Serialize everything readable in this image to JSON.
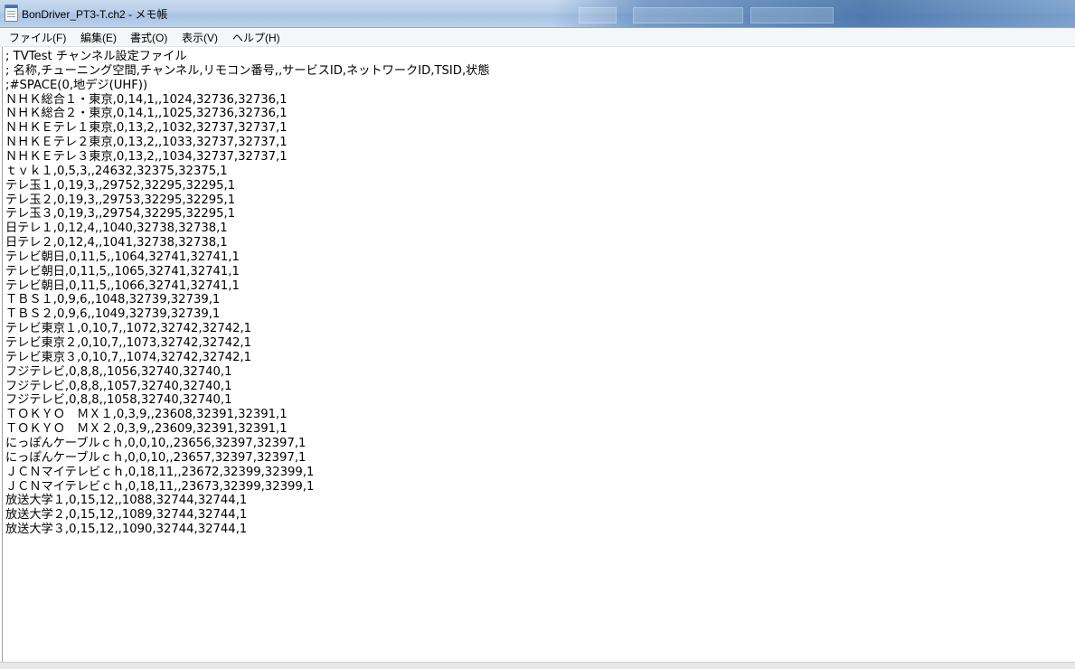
{
  "window": {
    "title": "BonDriver_PT3-T.ch2 - メモ帳"
  },
  "menu": [
    "ファイル(F)",
    "編集(E)",
    "書式(O)",
    "表示(V)",
    "ヘルプ(H)"
  ],
  "editor": {
    "lines": [
      "; TVTest チャンネル設定ファイル",
      "; 名称,チューニング空間,チャンネル,リモコン番号,,サービスID,ネットワークID,TSID,状態",
      ";#SPACE(0,地デジ(UHF))",
      "ＮＨＫ総合１・東京,0,14,1,,1024,32736,32736,1",
      "ＮＨＫ総合２・東京,0,14,1,,1025,32736,32736,1",
      "ＮＨＫＥテレ１東京,0,13,2,,1032,32737,32737,1",
      "ＮＨＫＥテレ２東京,0,13,2,,1033,32737,32737,1",
      "ＮＨＫＥテレ３東京,0,13,2,,1034,32737,32737,1",
      "ｔｖｋ１,0,5,3,,24632,32375,32375,1",
      "テレ玉１,0,19,3,,29752,32295,32295,1",
      "テレ玉２,0,19,3,,29753,32295,32295,1",
      "テレ玉３,0,19,3,,29754,32295,32295,1",
      "日テレ１,0,12,4,,1040,32738,32738,1",
      "日テレ２,0,12,4,,1041,32738,32738,1",
      "テレビ朝日,0,11,5,,1064,32741,32741,1",
      "テレビ朝日,0,11,5,,1065,32741,32741,1",
      "テレビ朝日,0,11,5,,1066,32741,32741,1",
      "ＴＢＳ１,0,9,6,,1048,32739,32739,1",
      "ＴＢＳ２,0,9,6,,1049,32739,32739,1",
      "テレビ東京１,0,10,7,,1072,32742,32742,1",
      "テレビ東京２,0,10,7,,1073,32742,32742,1",
      "テレビ東京３,0,10,7,,1074,32742,32742,1",
      "フジテレビ,0,8,8,,1056,32740,32740,1",
      "フジテレビ,0,8,8,,1057,32740,32740,1",
      "フジテレビ,0,8,8,,1058,32740,32740,1",
      "ＴＯＫＹＯ　ＭＸ１,0,3,9,,23608,32391,32391,1",
      "ＴＯＫＹＯ　ＭＸ２,0,3,9,,23609,32391,32391,1",
      "にっぽんケーブルｃｈ,0,0,10,,23656,32397,32397,1",
      "にっぽんケーブルｃｈ,0,0,10,,23657,32397,32397,1",
      "ＪＣＮマイテレビｃｈ,0,18,11,,23672,32399,32399,1",
      "ＪＣＮマイテレビｃｈ,0,18,11,,23673,32399,32399,1",
      "放送大学１,0,15,12,,1088,32744,32744,1",
      "放送大学２,0,15,12,,1089,32744,32744,1",
      "放送大学３,0,15,12,,1090,32744,32744,1"
    ]
  }
}
